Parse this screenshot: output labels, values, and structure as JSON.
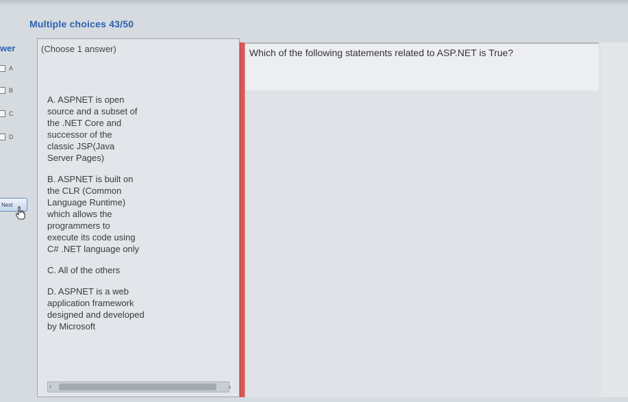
{
  "header": {
    "title": "Multiple choices 43/50"
  },
  "answer_sidebar": {
    "label": "wer",
    "options": [
      "A",
      "B",
      "C",
      "D"
    ],
    "next_label": "Next"
  },
  "choices_panel": {
    "hint": "(Choose 1 answer)",
    "options": [
      {
        "text": "A. ASPNET is open\nsource and a subset of\nthe .NET Core and\nsuccessor of the\nclassic JSP(Java\nServer Pages)"
      },
      {
        "text": "B. ASPNET is built on\nthe CLR (Common\nLanguage Runtime)\nwhich allows the\nprogrammers to\nexecute its code using\nC# .NET language only"
      },
      {
        "text": "C. All of the others"
      },
      {
        "text": "D. ASPNET is a web\napplication framework\ndesigned and developed\nby Microsoft"
      }
    ]
  },
  "question": {
    "text": "Which of the following statements related to ASP.NET is True?"
  },
  "colors": {
    "title_blue": "#2a5fb0",
    "divider_red": "#d65a5a"
  }
}
